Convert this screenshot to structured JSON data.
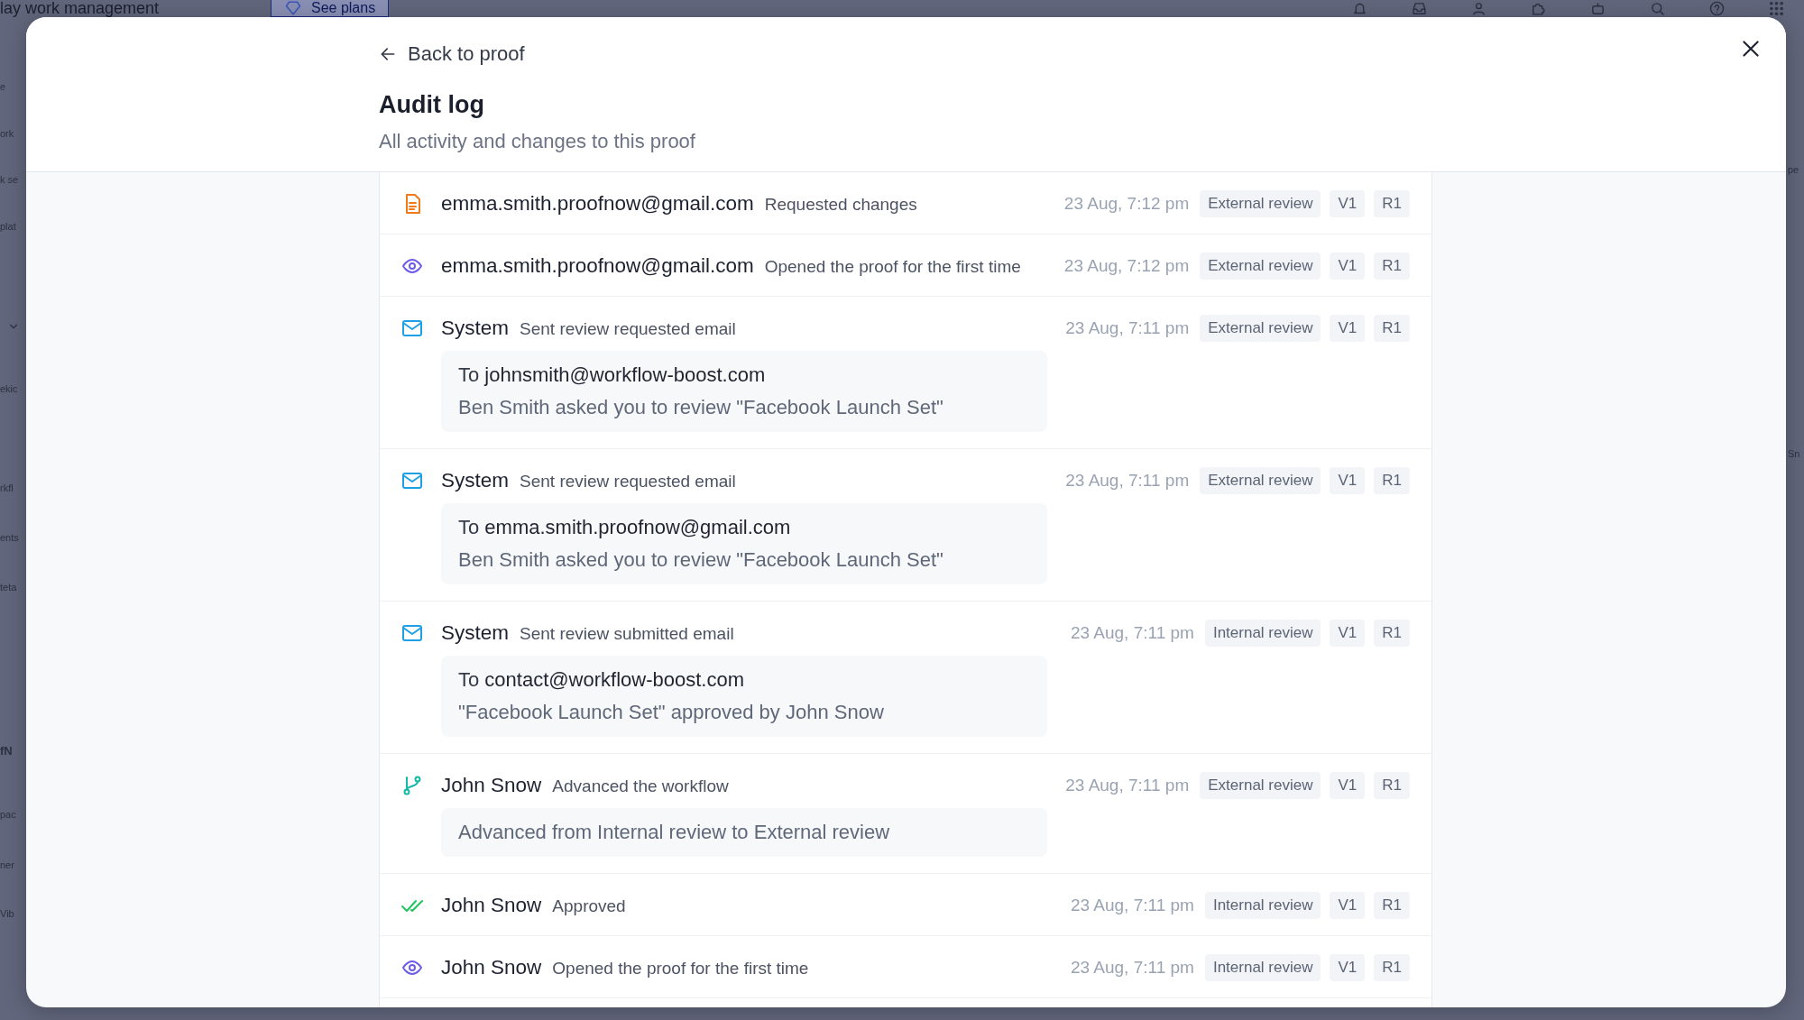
{
  "background_app": {
    "brand": "lay work management",
    "plans_button": "See plans",
    "sidebar_fragments": [
      "e",
      "ork",
      "k se",
      "plat",
      "ekic",
      "rkfl",
      "ents",
      "teta",
      "fN",
      "pac",
      "ner",
      "Vib"
    ],
    "right_fragments": [
      "pe",
      "Sn"
    ]
  },
  "dialog": {
    "back_link": "Back to proof",
    "title": "Audit log",
    "subtitle": "All activity and changes to this proof"
  },
  "entries": [
    {
      "kind": "document",
      "actor": "emma.smith.proofnow@gmail.com",
      "action": "Requested changes",
      "time": "23 Aug, 7:12 pm",
      "stage": "External review",
      "version": "V1",
      "round": "R1"
    },
    {
      "kind": "eye",
      "actor": "emma.smith.proofnow@gmail.com",
      "action": "Opened the proof for the first time",
      "time": "23 Aug, 7:12 pm",
      "stage": "External review",
      "version": "V1",
      "round": "R1"
    },
    {
      "kind": "mail",
      "actor": "System",
      "action": "Sent review requested email",
      "time": "23 Aug, 7:11 pm",
      "stage": "External review",
      "version": "V1",
      "round": "R1",
      "detail": [
        "To **johnsmith@workflow-boost.com**",
        "Ben Smith asked you to review \"Facebook Launch Set\""
      ]
    },
    {
      "kind": "mail",
      "actor": "System",
      "action": "Sent review requested email",
      "time": "23 Aug, 7:11 pm",
      "stage": "External review",
      "version": "V1",
      "round": "R1",
      "detail": [
        "To **emma.smith.proofnow@gmail.com**",
        "Ben Smith asked you to review \"Facebook Launch Set\""
      ]
    },
    {
      "kind": "mail",
      "actor": "System",
      "action": "Sent review submitted email",
      "time": "23 Aug, 7:11 pm",
      "stage": "Internal review",
      "version": "V1",
      "round": "R1",
      "detail": [
        "To **contact@workflow-boost.com**",
        "\"Facebook Launch Set\" approved by John Snow"
      ]
    },
    {
      "kind": "branch",
      "actor": "John Snow",
      "action": "Advanced the workflow",
      "time": "23 Aug, 7:11 pm",
      "stage": "External review",
      "version": "V1",
      "round": "R1",
      "detail": [
        "Advanced from Internal review to External review"
      ]
    },
    {
      "kind": "check",
      "actor": "John Snow",
      "action": "Approved",
      "time": "23 Aug, 7:11 pm",
      "stage": "Internal review",
      "version": "V1",
      "round": "R1"
    },
    {
      "kind": "eye",
      "actor": "John Snow",
      "action": "Opened the proof for the first time",
      "time": "23 Aug, 7:11 pm",
      "stage": "Internal review",
      "version": "V1",
      "round": "R1"
    }
  ]
}
